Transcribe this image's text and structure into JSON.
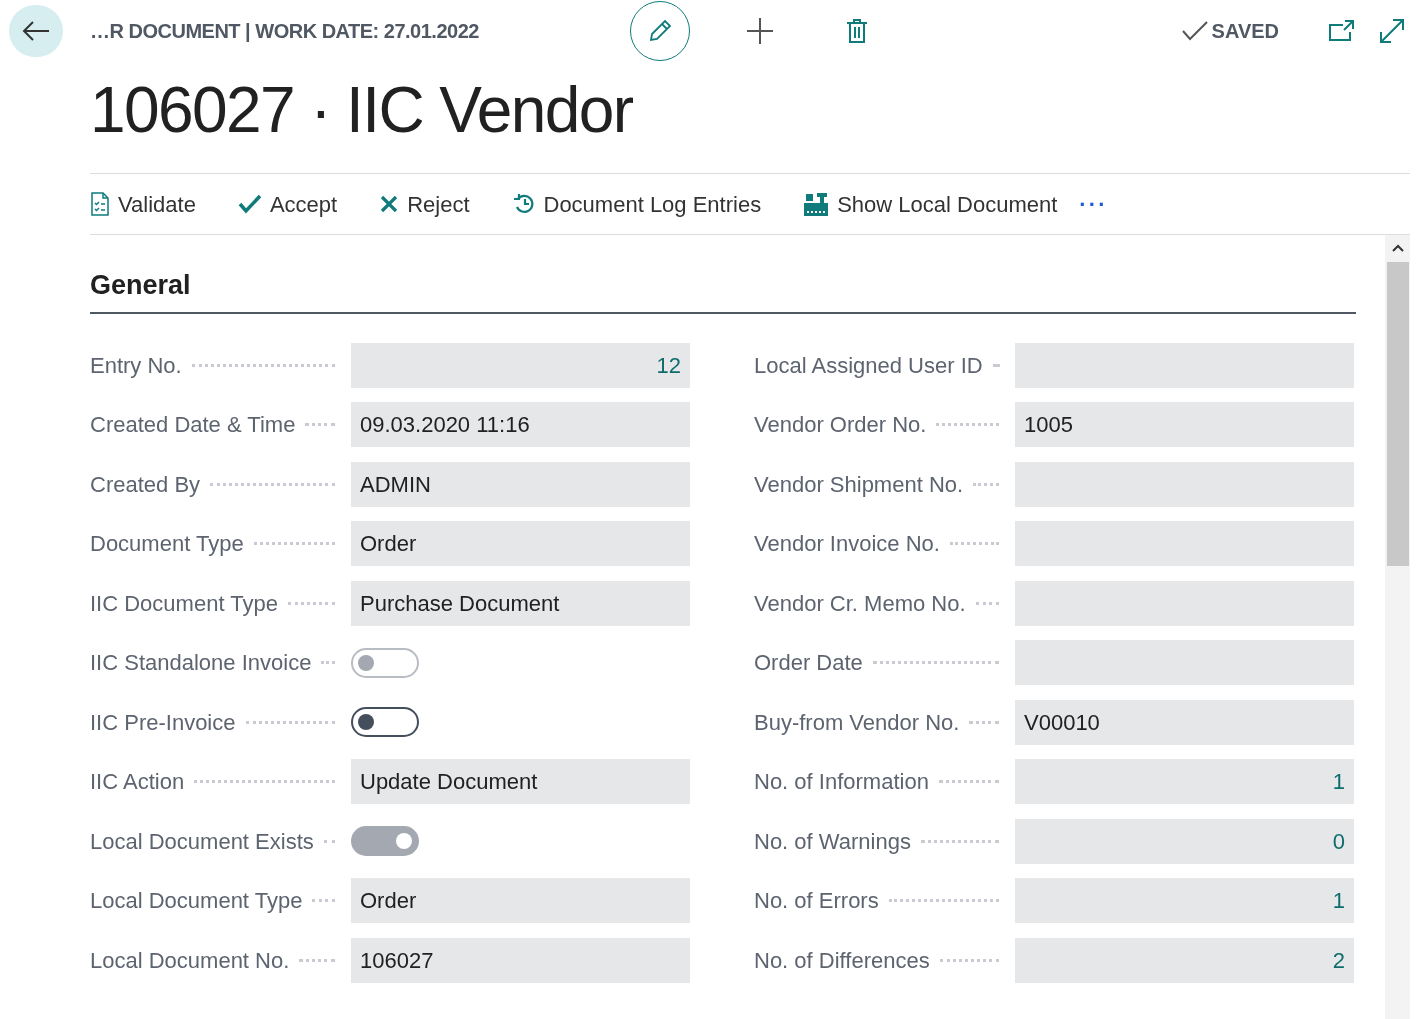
{
  "header": {
    "breadcrumb": "…R DOCUMENT | WORK DATE: 27.01.2022",
    "status": "SAVED",
    "title": "106027 · IIC Vendor"
  },
  "actions": [
    {
      "label": "Validate",
      "kind": "validate"
    },
    {
      "label": "Accept",
      "kind": "accept"
    },
    {
      "label": "Reject",
      "kind": "reject"
    },
    {
      "label": "Document Log Entries",
      "kind": "log"
    },
    {
      "label": "Show Local Document",
      "kind": "local"
    }
  ],
  "more": "···",
  "section": {
    "title": "General"
  },
  "left_fields": [
    {
      "label": "Entry No.",
      "kind": "number",
      "value": "12"
    },
    {
      "label": "Created Date & Time",
      "kind": "text",
      "value": "09.03.2020 11:16"
    },
    {
      "label": "Created By",
      "kind": "text",
      "value": "ADMIN"
    },
    {
      "label": "Document Type",
      "kind": "text",
      "value": "Order"
    },
    {
      "label": "IIC Document Type",
      "kind": "text",
      "value": "Purchase Document"
    },
    {
      "label": "IIC Standalone Invoice",
      "kind": "toggle",
      "on": false,
      "disabled": true
    },
    {
      "label": "IIC Pre-Invoice",
      "kind": "toggle",
      "on": false,
      "disabled": false
    },
    {
      "label": "IIC Action",
      "kind": "text",
      "value": "Update Document"
    },
    {
      "label": "Local Document Exists",
      "kind": "toggle",
      "on": true,
      "disabled": true
    },
    {
      "label": "Local Document Type",
      "kind": "text",
      "value": "Order"
    },
    {
      "label": "Local Document No.",
      "kind": "text",
      "value": "106027"
    }
  ],
  "right_fields": [
    {
      "label": "Local Assigned User ID",
      "kind": "text"
    },
    {
      "label": "Vendor Order No.",
      "kind": "text",
      "value": "1005"
    },
    {
      "label": "Vendor Shipment No.",
      "kind": "text"
    },
    {
      "label": "Vendor Invoice No.",
      "kind": "text"
    },
    {
      "label": "Vendor Cr. Memo No.",
      "kind": "text"
    },
    {
      "label": "Order Date",
      "kind": "text"
    },
    {
      "label": "Buy-from Vendor No.",
      "kind": "text",
      "value": "V00010"
    },
    {
      "label": "No. of Information",
      "kind": "number",
      "value": "1"
    },
    {
      "label": "No. of Warnings",
      "kind": "number",
      "value": "0"
    },
    {
      "label": "No. of Errors",
      "kind": "number",
      "value": "1"
    },
    {
      "label": "No. of Differences",
      "kind": "number",
      "value": "2"
    }
  ]
}
